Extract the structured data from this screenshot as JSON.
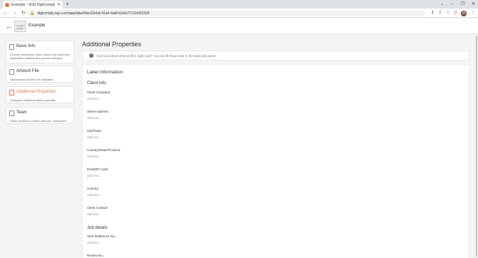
{
  "browser": {
    "tab_title": "Example - SGS DigiComply",
    "url": "digicomply.sgs.com/app/label/0ec02ebd-41a4-4afd-b2a0-f7122ef11504",
    "profile_initial": "M"
  },
  "header": {
    "thumbnail_text": "no label artwork",
    "label_name": "Example"
  },
  "sidebar": {
    "steps": [
      {
        "title": "Basic Info",
        "desc": "Choose Descriptive Label Name and select the distribution markets and product category."
      },
      {
        "title": "Artwork File",
        "desc": "Upload artwork file to be validated."
      },
      {
        "title": "Additional Properties",
        "desc": "Configure additional label properties"
      },
      {
        "title": "Team",
        "desc": "Share access to a label with your colleagues."
      }
    ]
  },
  "main": {
    "title": "Additional Properties",
    "notice": "Not sure about what to fill in right now? You can fill these later in the label info panel.",
    "card_title": "Label Information",
    "sections": [
      {
        "title": "Client info",
        "fields": [
          {
            "label": "Client Company:",
            "placeholder": "add text..."
          },
          {
            "label": "Street Address:",
            "placeholder": "add text..."
          },
          {
            "label": "City/Town:",
            "placeholder": "add text..."
          },
          {
            "label": "Country/State/Province:",
            "placeholder": "add text..."
          },
          {
            "label": "Post/ZIP Code:",
            "placeholder": "add text..."
          },
          {
            "label": "Country:",
            "placeholder": "add text..."
          },
          {
            "label": "Client Contact:",
            "placeholder": "add text..."
          }
        ]
      },
      {
        "title": "Job details",
        "fields": [
          {
            "label": "SGS Reference No.:",
            "placeholder": "add text..."
          },
          {
            "label": "Review No.:",
            "placeholder": ""
          }
        ]
      }
    ]
  },
  "colors": {
    "accent": "#e8743b"
  }
}
